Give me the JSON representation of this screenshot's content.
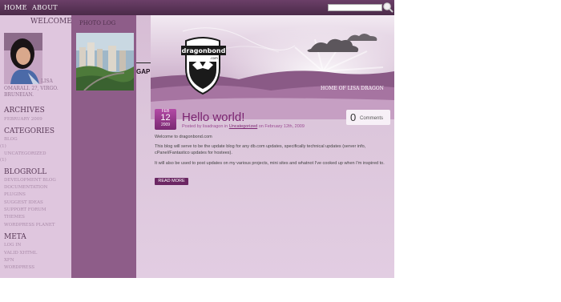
{
  "nav": {
    "home": "HOME",
    "about": "ABOUT"
  },
  "search": {
    "value": ""
  },
  "sidebar": {
    "welcome": "WELCOME",
    "bio_lines": [
      "LISA",
      "OMARALI. 2?, VIRGO.",
      "BRUNEIAN."
    ],
    "archives": {
      "title": "ARCHIVES",
      "items": [
        "FEBRUARY 2009"
      ]
    },
    "categories": {
      "title": "CATEGORIES",
      "items": [
        "BLOG",
        "(1)",
        "UNCATEGORIZED",
        "(1)"
      ]
    },
    "blogroll": {
      "title": "BLOGROLL",
      "items": [
        "DEVELOPMENT BLOG",
        "DOCUMENTATION",
        "PLUGINS",
        "SUGGEST IDEAS",
        "SUPPORT FORUM",
        "THEMES",
        "WORDPRESS PLANET"
      ]
    },
    "meta": {
      "title": "META",
      "items": [
        "LOG IN",
        "VALID XHTML",
        "XFN",
        "WORDPRESS"
      ]
    }
  },
  "photolog": {
    "title": "PHOTO LOG"
  },
  "gap": "GAP",
  "header": {
    "logo_text": "dragonbond",
    "logo_sub": ".com",
    "tagline": "HOME OF LISA DRAGON"
  },
  "post": {
    "date": {
      "month": "FEB",
      "day": "12",
      "year": "2009"
    },
    "title": "Hello world!",
    "meta": {
      "prefix": "Posted by",
      "author": "lisadragon",
      "in": "in",
      "category": "Uncategorized",
      "on": "on February 12th, 2009"
    },
    "comments": {
      "count": "0",
      "label": "Comments"
    },
    "paragraphs": [
      "Welcome to dragonbond.com",
      "This blog will serve to be the update blog for any db.com updates, specifically technical updates (server info, cPanel/Fantastico updates for hostees).",
      "It will also be used to post updates on my various projects, mini sites and whatnot I've cooked up when I'm inspired to."
    ],
    "read_more": "READ MORE"
  }
}
